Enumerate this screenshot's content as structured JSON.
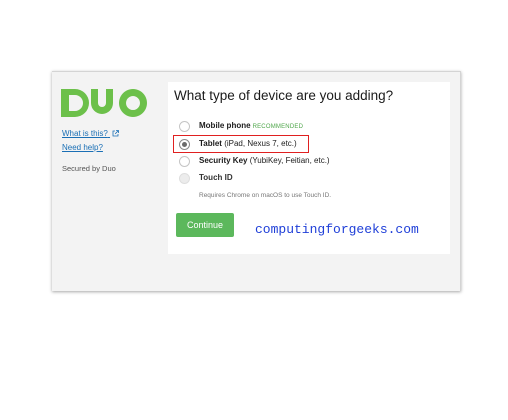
{
  "sidebar": {
    "brand": "DUO",
    "links": [
      {
        "label": "What is this?",
        "icon": "external-link-icon"
      },
      {
        "label": "Need help?"
      }
    ],
    "secured_text": "Secured by Duo"
  },
  "prompt": {
    "title": "What type of device are you adding?",
    "options": [
      {
        "label": "Mobile phone",
        "detail": "",
        "tag": "RECOMMENDED",
        "selected": false,
        "disabled": false
      },
      {
        "label": "Tablet",
        "detail": "(iPad, Nexus 7, etc.)",
        "tag": "",
        "selected": true,
        "disabled": false
      },
      {
        "label": "Security Key",
        "detail": "(YubiKey, Feitian, etc.)",
        "tag": "",
        "selected": false,
        "disabled": false
      },
      {
        "label": "Touch ID",
        "detail": "",
        "tag": "",
        "selected": false,
        "disabled": true
      }
    ],
    "touch_id_note": "Requires Chrome on macOS to use Touch ID.",
    "continue_label": "Continue"
  },
  "watermark": "computingforgeeks.com",
  "colors": {
    "brand_green": "#6cc04a",
    "button_green": "#5cb85c",
    "link_blue": "#1a6fb5",
    "highlight_red": "#e02020",
    "watermark_blue": "#1f3fd8"
  }
}
